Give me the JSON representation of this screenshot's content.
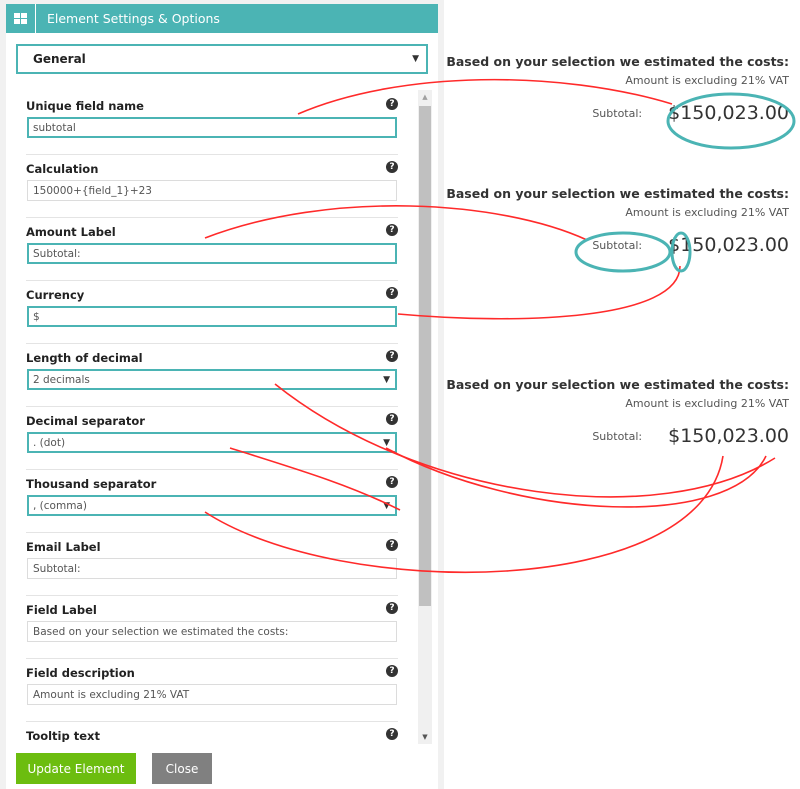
{
  "panel": {
    "title": "Element Settings & Options",
    "section_select": "General",
    "fields": [
      {
        "label": "Unique field name",
        "value": "subtotal",
        "type": "text",
        "highlighted": true
      },
      {
        "label": "Calculation",
        "value": "150000+{field_1}+23",
        "type": "text",
        "highlighted": false
      },
      {
        "label": "Amount Label",
        "value": "Subtotal:",
        "type": "text",
        "highlighted": true
      },
      {
        "label": "Currency",
        "value": "$",
        "type": "text",
        "highlighted": true
      },
      {
        "label": "Length of decimal",
        "value": "2 decimals",
        "type": "select",
        "highlighted": true
      },
      {
        "label": "Decimal separator",
        "value": ". (dot)",
        "type": "select",
        "highlighted": true
      },
      {
        "label": "Thousand separator",
        "value": ", (comma)",
        "type": "select",
        "highlighted": true
      },
      {
        "label": "Email Label",
        "value": "Subtotal:",
        "type": "text",
        "highlighted": false
      },
      {
        "label": "Field Label",
        "value": "Based on your selection we estimated the costs:",
        "type": "text",
        "highlighted": false
      },
      {
        "label": "Field description",
        "value": "Amount is excluding 21% VAT",
        "type": "text",
        "highlighted": false
      },
      {
        "label": "Tooltip text",
        "value": "",
        "type": "text",
        "highlighted": false
      }
    ],
    "help_glyph": "?",
    "caret_glyph": "▼",
    "buttons": {
      "update": "Update Element",
      "close": "Close"
    }
  },
  "previews": [
    {
      "label": "Based on your selection we estimated the costs:",
      "description": "Amount is excluding 21% VAT",
      "amount_label": "Subtotal:",
      "amount": "$150,023.00"
    },
    {
      "label": "Based on your selection we estimated the costs:",
      "description": "Amount is excluding 21% VAT",
      "amount_label": "Subtotal:",
      "amount": "$150,023.00"
    },
    {
      "label": "Based on your selection we estimated the costs:",
      "description": "Amount is excluding 21% VAT",
      "amount_label": "Subtotal:",
      "amount": "$150,023.00"
    }
  ],
  "colors": {
    "accent": "#4bb4b4",
    "update_button": "#6cbd0f",
    "close_button": "#808080",
    "annotation_line": "#ff2020"
  }
}
